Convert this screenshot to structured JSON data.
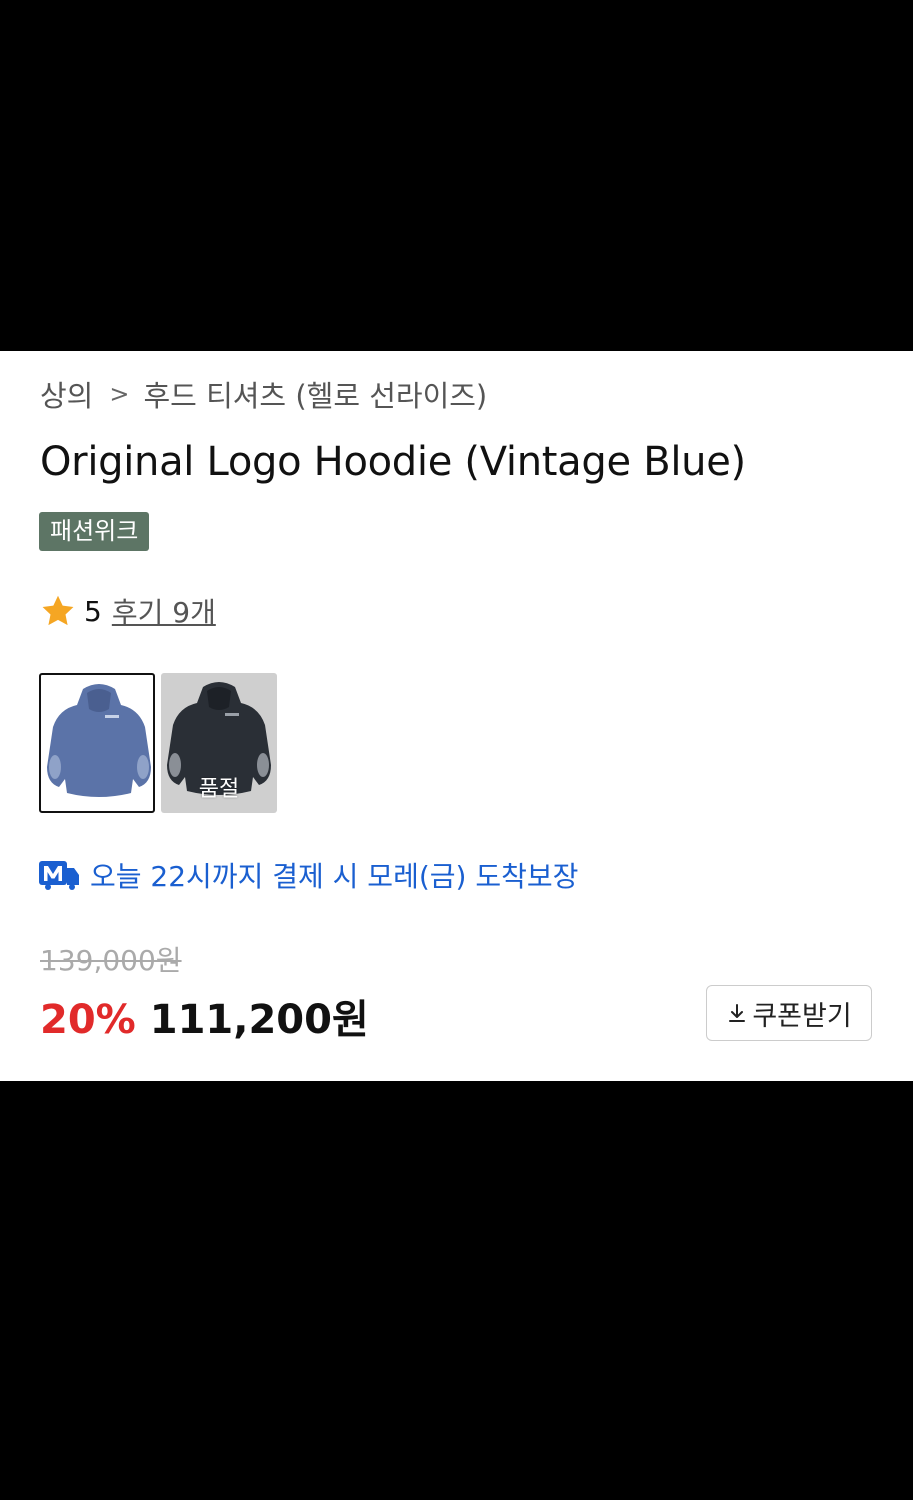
{
  "breadcrumb": {
    "category": "상의",
    "separator": ">",
    "subcategory": "후드 티셔츠 (헬로 선라이즈)"
  },
  "product": {
    "title": "Original Logo Hoodie (Vintage Blue)",
    "badge": "패션위크"
  },
  "rating": {
    "score": "5",
    "reviews_label": "후기 9개",
    "star_color": "#f5a623"
  },
  "thumbnails": [
    {
      "name": "vintage-blue",
      "selected": true,
      "sold_out": false,
      "color": "#5b73a8"
    },
    {
      "name": "black",
      "selected": false,
      "sold_out": true,
      "color": "#2a2f36",
      "sold_out_label": "품절"
    }
  ],
  "delivery": {
    "icon": "truck-m-icon",
    "text": "오늘 22시까지 결제 시 모레(금) 도착보장",
    "color": "#1a5fd0"
  },
  "pricing": {
    "original_price": "139,000원",
    "discount": "20%",
    "price": "111,200원",
    "discount_color": "#e12a2a"
  },
  "coupon": {
    "label": "쿠폰받기",
    "icon": "download-icon"
  }
}
